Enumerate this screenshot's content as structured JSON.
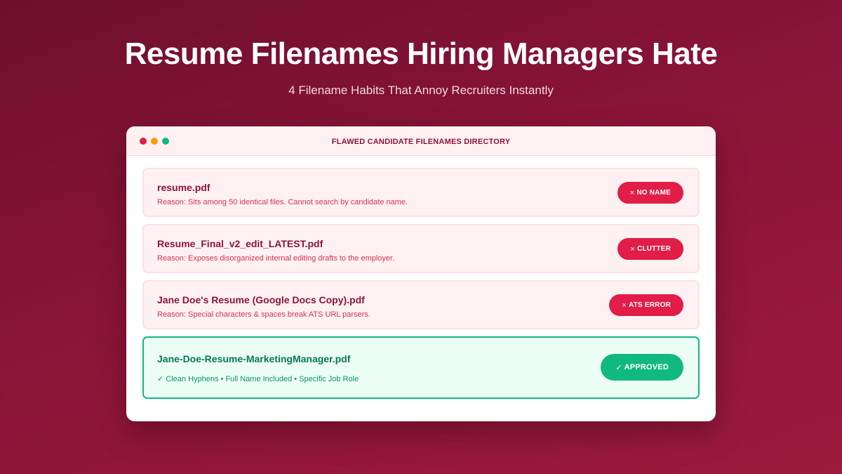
{
  "header": {
    "title": "Resume Filenames Hiring Managers Hate",
    "subtitle": "4 Filename Habits That Annoy Recruiters Instantly"
  },
  "window": {
    "title": "FLAWED CANDIDATE FILENAMES DIRECTORY"
  },
  "rows": [
    {
      "filename": "resume.pdf",
      "reason": "Reason: Sits among 50 identical files. Cannot search by candidate name.",
      "badge_icon": "×",
      "badge": "NO NAME"
    },
    {
      "filename": "Resume_Final_v2_edit_LATEST.pdf",
      "reason": "Reason: Exposes disorganized internal editing drafts to the employer.",
      "badge_icon": "×",
      "badge": "CLUTTER"
    },
    {
      "filename": "Jane Doe's Resume (Google Docs Copy).pdf",
      "reason": "Reason: Special characters & spaces break ATS URL parsers.",
      "badge_icon": "×",
      "badge": "ATS ERROR"
    },
    {
      "filename": "Jane-Doe-Resume-MarketingManager.pdf",
      "reason": "✓ Clean Hyphens • Full Name Included • Specific Job Role",
      "badge_icon": "✓",
      "badge": "APPROVED"
    }
  ],
  "colors": {
    "background": "#8a1438",
    "error": "#e11d48",
    "success": "#10b981"
  }
}
